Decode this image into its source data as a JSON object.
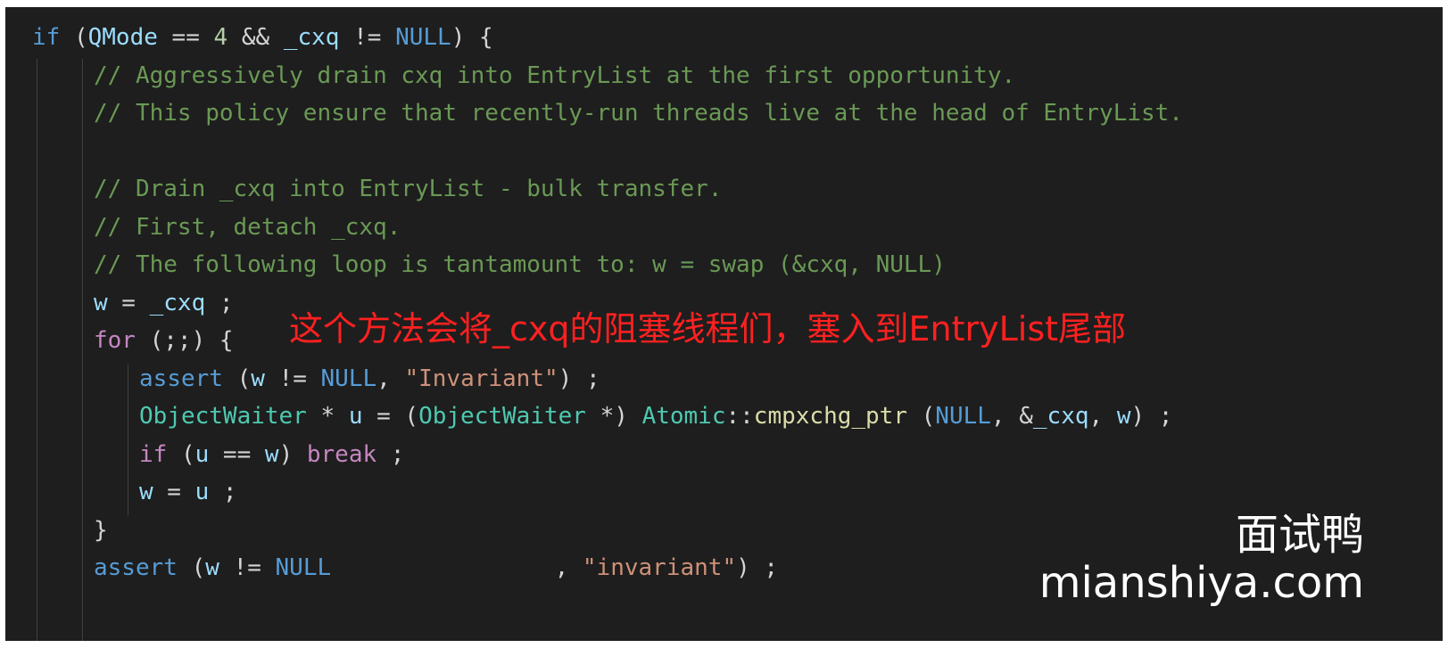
{
  "code": {
    "line1": {
      "if_kw": "if",
      "p_open": " (",
      "qmode": "QMode",
      "eq": " == ",
      "four": "4",
      "and": " && ",
      "cxq": "_cxq",
      "neq": " != ",
      "null": "NULL",
      "p_close": ") {"
    },
    "line2": "// Aggressively drain cxq into EntryList at the first opportunity.",
    "line3": "// This policy ensure that recently-run threads live at the head of EntryList.",
    "line5": "// Drain _cxq into EntryList - bulk transfer.",
    "line6": "// First, detach _cxq.",
    "line7": "// The following loop is tantamount to: w = swap (&cxq, NULL)",
    "line8": {
      "w": "w",
      "assign": " = ",
      "cxq": "_cxq",
      "end": " ;"
    },
    "line9": {
      "for_kw": "for",
      "rest": " (;;) {"
    },
    "line10": {
      "assert_kw": "assert",
      "p_open": " (",
      "w": "w",
      "neq": " != ",
      "null": "NULL",
      "comma": ", ",
      "str": "\"Invariant\"",
      "end": ") ;"
    },
    "line11": {
      "type1": "ObjectWaiter",
      "star": " * ",
      "u": "u",
      "assign": " = (",
      "type2": "ObjectWaiter",
      "cast": " *) ",
      "ns": "Atomic",
      "sep": "::",
      "fn": "cmpxchg_ptr",
      "p_open": " (",
      "null": "NULL",
      "amp": ", &",
      "cxq": "_cxq",
      "comma": ", ",
      "w": "w",
      "end": ") ;"
    },
    "line12": {
      "if_kw": "if",
      "p_open": " (",
      "u": "u",
      "eq": " == ",
      "w": "w",
      "p_close": ") ",
      "break_kw": "break",
      "end": " ;"
    },
    "line13": {
      "w": "w",
      "assign": " = ",
      "u": "u",
      "end": " ;"
    },
    "line14": "}",
    "line15": {
      "assert_kw": "assert",
      "p_open": " (",
      "w": "w",
      "neq": " != ",
      "null": "NULL",
      "gap": "                ",
      "comma": ", ",
      "str": "\"invariant\"",
      "end": ") ;"
    }
  },
  "annotation": "这个方法会将_cxq的阻塞线程们，塞入到EntryList尾部",
  "watermark": {
    "cn": "面试鸭",
    "en": "mianshiya.com"
  },
  "colors": {
    "background": "#1e1e1e",
    "keyword": "#569cd6",
    "control": "#c586c0",
    "variable": "#9cdcfe",
    "comment": "#6a9955",
    "string": "#ce9178",
    "type": "#4ec9b0",
    "function": "#dcdcaa",
    "annotation": "#ff2020"
  }
}
